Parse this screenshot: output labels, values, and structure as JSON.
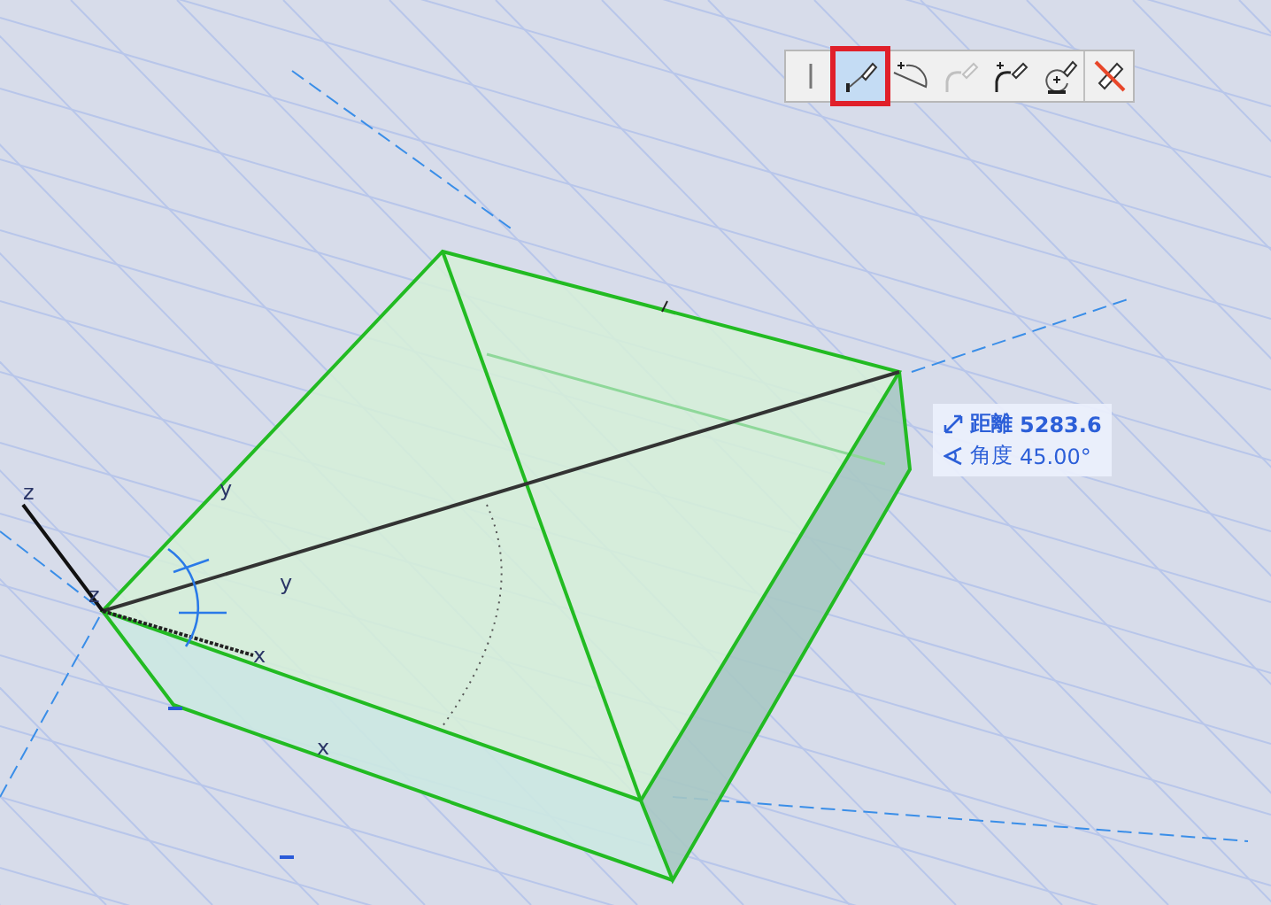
{
  "toolbar": {
    "buttons": [
      {
        "kind": "line",
        "selected": false
      },
      {
        "kind": "pencil",
        "selected": true
      },
      {
        "kind": "arc",
        "selected": false
      },
      {
        "kind": "curve",
        "selected": false,
        "disabled": true
      },
      {
        "kind": "spline",
        "selected": false
      },
      {
        "kind": "circle",
        "selected": false
      },
      {
        "kind": "cancel",
        "selected": false
      }
    ]
  },
  "tooltip": {
    "lines": [
      {
        "kind": "distance",
        "label": "距離",
        "value": "5283.6"
      },
      {
        "kind": "angle",
        "label": "角度",
        "value": "45.00°"
      }
    ]
  },
  "axis_labels": [
    {
      "text": "z"
    },
    {
      "text": "y"
    },
    {
      "text": "z"
    },
    {
      "text": "y"
    },
    {
      "text": "x"
    },
    {
      "text": "x"
    }
  ]
}
